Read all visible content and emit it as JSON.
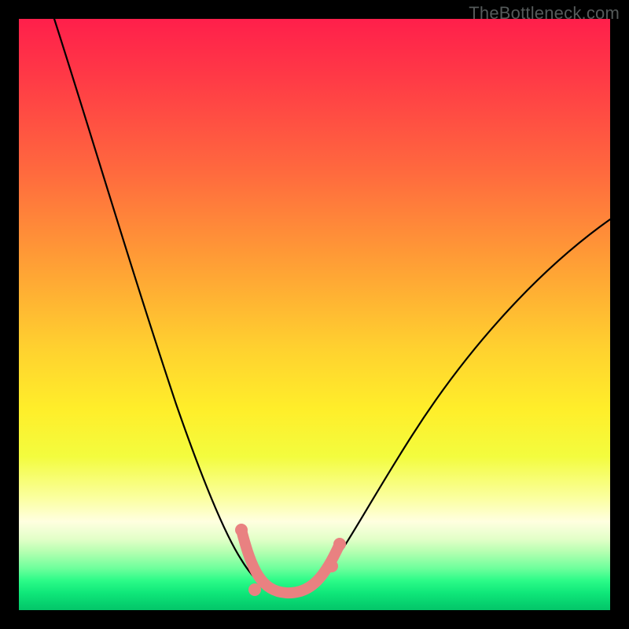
{
  "watermark": "TheBottleneck.com",
  "colors": {
    "gradient_top": "#ff1f4b",
    "gradient_mid": "#ffee2a",
    "gradient_bottom": "#04c569",
    "curve": "#000000",
    "highlight": "#e98181",
    "background": "#000000"
  },
  "chart_data": {
    "type": "line",
    "title": "",
    "xlabel": "",
    "ylabel": "",
    "xlim": [
      0,
      100
    ],
    "ylim": [
      0,
      100
    ],
    "note": "Axes and ticks are not rendered in the source image; x/y values are read off the pixel grid as percentages of the plot area (0 = left/bottom, 100 = right/top). Lower y = closer to the green optimum.",
    "series": [
      {
        "name": "bottleneck-curve",
        "x": [
          6,
          10,
          14,
          18,
          22,
          26,
          30,
          34,
          37,
          39,
          41,
          43,
          45,
          48,
          52,
          56,
          60,
          66,
          74,
          82,
          90,
          100
        ],
        "y": [
          100,
          87,
          74,
          62,
          50,
          39,
          29,
          20,
          13,
          9,
          6,
          4,
          3,
          3,
          4,
          7,
          12,
          20,
          32,
          44,
          55,
          66
        ]
      }
    ],
    "highlight": {
      "name": "near-optimal-segment",
      "x": [
        37.5,
        39,
        41,
        43,
        45,
        48,
        51,
        53,
        55
      ],
      "y": [
        13,
        9,
        6,
        4,
        3,
        3,
        4,
        7,
        11
      ]
    }
  }
}
